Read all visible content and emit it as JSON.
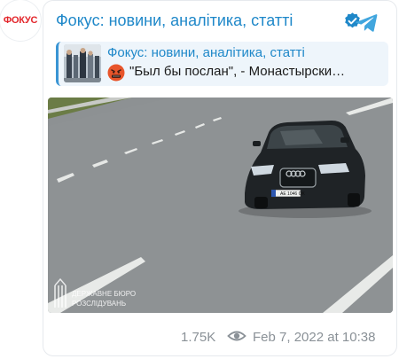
{
  "avatar": {
    "text": "ФОКУС"
  },
  "post": {
    "channel_name": "Фокус: новини, аналітика, статті",
    "verified": true
  },
  "forwarded": {
    "title": "Фокус: новини, аналітика, статті",
    "text": "\"Был бы послан\", - Монастырски…",
    "emoji": "angry-face-icon"
  },
  "photo": {
    "plate": "AE 1046 OK",
    "watermark_line1": "ДЕРЖАВНЕ БЮРО",
    "watermark_line2": "РОЗСЛІДУВАНЬ"
  },
  "footer": {
    "views": "1.75K",
    "date": "Feb 7, 2022 at 10:38"
  },
  "colors": {
    "accent": "#1f88c9",
    "brand_red": "#e3262b",
    "muted": "#8a9197"
  }
}
